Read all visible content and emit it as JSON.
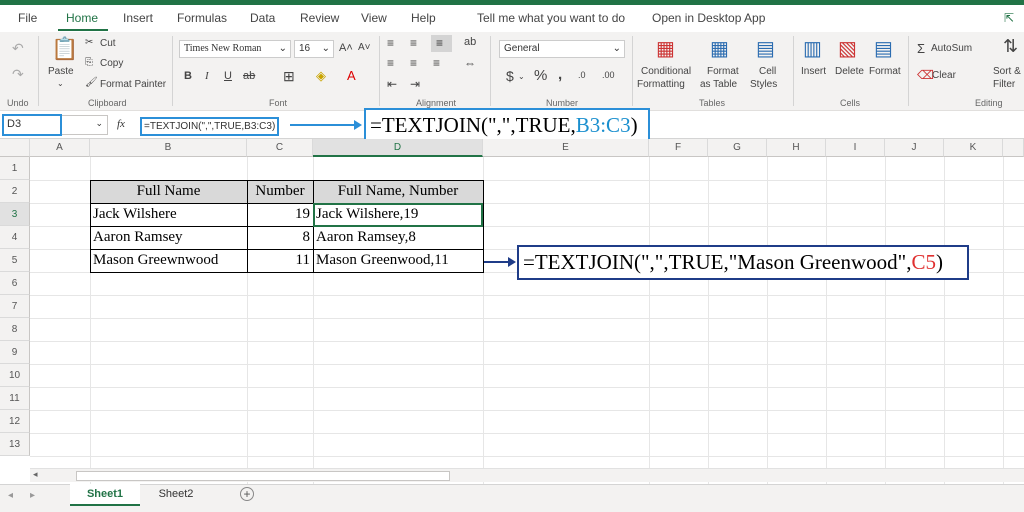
{
  "tabs": [
    "File",
    "Home",
    "Insert",
    "Formulas",
    "Data",
    "Review",
    "View",
    "Help",
    "Tell me what you want to do",
    "Open in Desktop App"
  ],
  "ribbon": {
    "undo_label": "Undo",
    "paste_label": "Paste",
    "cut_label": "Cut",
    "copy_label": "Copy",
    "format_painter_label": "Format Painter",
    "clipboard_label": "Clipboard",
    "font_name": "Times New Roman",
    "font_size": "16",
    "font_label": "Font",
    "alignment_label": "Alignment",
    "number_format": "General",
    "number_label": "Number",
    "conditional_formatting": [
      "Conditional",
      "Formatting"
    ],
    "format_as_table": [
      "Format",
      "as Table"
    ],
    "cell_styles": [
      "Cell",
      "Styles"
    ],
    "tables_label": "Tables",
    "insert_label": "Insert",
    "delete_label": "Delete",
    "format_label": "Format",
    "cells_label": "Cells",
    "autosum_label": "AutoSum",
    "clear_label": "Clear",
    "sort_filter": [
      "Sort &",
      "Filter"
    ],
    "editing_label": "Editing"
  },
  "formula_bar": {
    "name_box": "D3",
    "fx": "fx",
    "formula": "=TEXTJOIN(\",\",TRUE,B3:C3)"
  },
  "callout1": {
    "prefix": "=TEXTJOIN(\",\",TRUE,",
    "ref": "B3:C3",
    "suffix": ")"
  },
  "callout2": {
    "prefix": "=TEXTJOIN(\",\",TRUE,\"Mason Greenwood\",",
    "ref": "C5",
    "suffix": ")"
  },
  "columns": [
    "A",
    "B",
    "C",
    "D",
    "E",
    "F",
    "G",
    "H",
    "I",
    "J",
    "K"
  ],
  "rows": [
    "1",
    "2",
    "3",
    "4",
    "5",
    "6",
    "7",
    "8",
    "9",
    "10",
    "11",
    "12",
    "13"
  ],
  "table": {
    "headers": [
      "Full Name",
      "Number",
      "Full Name, Number"
    ],
    "rows": [
      [
        "Jack Wilshere",
        "19",
        "Jack Wilshere,19"
      ],
      [
        "Aaron Ramsey",
        "8",
        "Aaron Ramsey,8"
      ],
      [
        "Mason Greewnwood",
        "11",
        "Mason Greenwood,11"
      ]
    ]
  },
  "sheets": [
    "Sheet1",
    "Sheet2"
  ],
  "colors": {
    "accent": "#217346",
    "callout_blue": "#2b8fd8",
    "callout_navy": "#1f3c88",
    "ref_red": "#e03030"
  }
}
